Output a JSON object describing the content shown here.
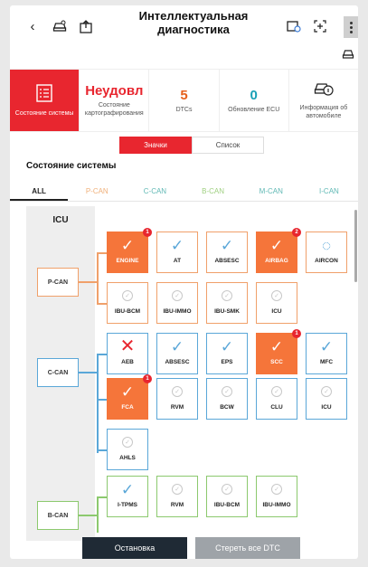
{
  "header": {
    "title": "Интеллектуальная диагностика",
    "back_icon": "back-arrow-icon",
    "vehicle_icon": "vehicle-icon",
    "settings_icon": "gear-icon",
    "export_icon": "export-icon",
    "add_icon": "add-icon"
  },
  "summary": {
    "system_status_label": "Состояние системы",
    "result_value": "Неудовл",
    "result_label": "Состояние картографирования",
    "dtc_value": "5",
    "dtc_label": "DTCs",
    "ecu_value": "0",
    "ecu_label": "Обновление ECU",
    "info_label": "Информация об автомобиле"
  },
  "view_toggle": {
    "icons": "Значки",
    "list": "Список"
  },
  "section_title": "Состояние системы",
  "tabs": [
    "ALL",
    "P-CAN",
    "C-CAN",
    "B-CAN",
    "M-CAN",
    "I-CAN"
  ],
  "side_header": "ICU",
  "buses": [
    "P-CAN",
    "C-CAN",
    "B-CAN"
  ],
  "modules": [
    {
      "name": "ENGINE",
      "state": "fail",
      "dtc": "1"
    },
    {
      "name": "AT",
      "state": "ok"
    },
    {
      "name": "ABSESC",
      "state": "ok"
    },
    {
      "name": "AIRBAG",
      "state": "fail",
      "dtc": "2"
    },
    {
      "name": "AIRCON",
      "state": "loading"
    },
    {
      "name": "IBU-BCM",
      "state": "na"
    },
    {
      "name": "IBU-IMMO",
      "state": "na"
    },
    {
      "name": "IBU-SMK",
      "state": "na"
    },
    {
      "name": "ICU",
      "state": "na"
    },
    {
      "name": "AEB",
      "state": "error"
    },
    {
      "name": "ABSESC",
      "state": "ok"
    },
    {
      "name": "EPS",
      "state": "ok"
    },
    {
      "name": "SCC",
      "state": "fail",
      "dtc": "1"
    },
    {
      "name": "MFC",
      "state": "ok"
    },
    {
      "name": "FCA",
      "state": "fail",
      "dtc": "1"
    },
    {
      "name": "RVM",
      "state": "na"
    },
    {
      "name": "BCW",
      "state": "na"
    },
    {
      "name": "CLU",
      "state": "na"
    },
    {
      "name": "ICU",
      "state": "na"
    },
    {
      "name": "AHLS",
      "state": "na"
    },
    {
      "name": "I-TPMS",
      "state": "ok"
    },
    {
      "name": "RVM",
      "state": "na"
    },
    {
      "name": "IBU-BCM",
      "state": "na"
    },
    {
      "name": "IBU-IMMO",
      "state": "na"
    }
  ],
  "buttons": {
    "stop": "Остановка",
    "clear": "Стереть все DTC"
  },
  "colors": {
    "red": "#e8262f",
    "fail": "#f5753a",
    "pcan": "#f0a06a",
    "ccan": "#5aa7d8",
    "bcan": "#8cc96e"
  }
}
